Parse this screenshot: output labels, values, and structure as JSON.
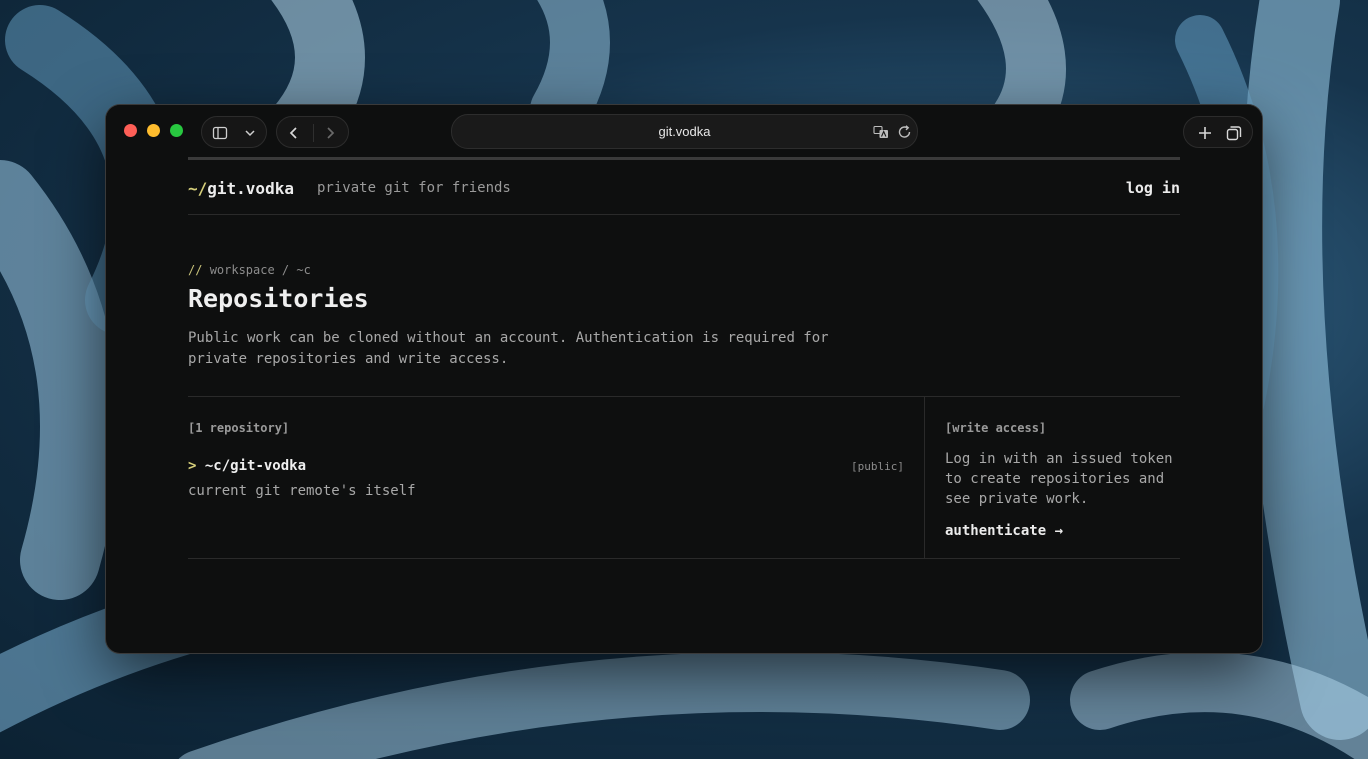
{
  "browser": {
    "url": "git.vodka",
    "icons": {
      "sidebar": "sidebar-icon",
      "sidebar_menu": "chevron-down-icon",
      "back": "chevron-left-icon",
      "forward": "chevron-right-icon",
      "translate": "translate-icon",
      "reload": "reload-icon",
      "new_tab": "plus-icon",
      "tabs": "tabs-overview-icon"
    }
  },
  "site": {
    "brand_tilde": "~/",
    "brand_name": "git.vodka",
    "tagline": "private git for friends",
    "login": "log in"
  },
  "page": {
    "crumb_slashes": "//",
    "crumb": "workspace / ~c",
    "title": "Repositories",
    "description": "Public work can be cloned without an account. Authentication is required for private repositories and write access."
  },
  "repos": {
    "count_label": "[1 repository]",
    "items": [
      {
        "caret": ">",
        "name": "~c/git-vodka",
        "badge": "[public]",
        "description": "current git remote's itself"
      }
    ]
  },
  "sidebar_panel": {
    "title": "[write access]",
    "text": "Log in with an issued token to create repositories and see private work.",
    "link": "authenticate →"
  },
  "colors": {
    "accent": "#d6cf7a",
    "page_bg": "#0e0f0f",
    "text": "#ececec",
    "muted": "#a8a8a8"
  }
}
